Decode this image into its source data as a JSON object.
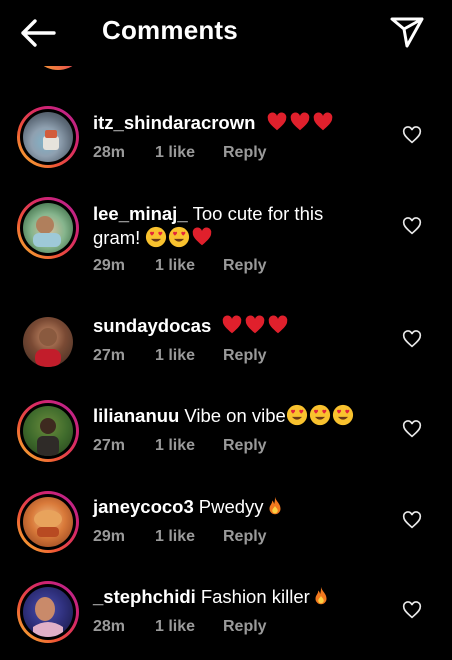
{
  "header": {
    "title": "Comments",
    "back_icon": "arrow-left-icon",
    "share_icon": "paper-plane-icon"
  },
  "colors": {
    "background": "#000000",
    "meta_text": "#9a9a9a",
    "story_ring_start": "#f7c531",
    "story_ring_end": "#b2239a",
    "heart": "#e0202c"
  },
  "comments": [
    {
      "username": "itz_shindaracrown",
      "text": "",
      "emojis": [
        "red-heart",
        "red-heart",
        "red-heart"
      ],
      "time": "28m",
      "likes": "1 like",
      "reply": "Reply",
      "story_ring": true
    },
    {
      "username": "lee_minaj_",
      "text": "Too cute for this",
      "text_line2": "gram!",
      "emojis": [
        "heart-eyes",
        "heart-eyes",
        "red-heart"
      ],
      "time": "29m",
      "likes": "1 like",
      "reply": "Reply",
      "story_ring": true
    },
    {
      "username": "sundaydocas",
      "text": "",
      "emojis": [
        "red-heart",
        "red-heart",
        "red-heart"
      ],
      "time": "27m",
      "likes": "1 like",
      "reply": "Reply",
      "story_ring": false
    },
    {
      "username": "liliananuu",
      "text": "Vibe on vibe",
      "emojis": [
        "heart-eyes",
        "heart-eyes",
        "heart-eyes"
      ],
      "time": "27m",
      "likes": "1 like",
      "reply": "Reply",
      "story_ring": true
    },
    {
      "username": "janeycoco3",
      "text": "Pwedyy",
      "emojis": [
        "fire"
      ],
      "time": "29m",
      "likes": "1 like",
      "reply": "Reply",
      "story_ring": true
    },
    {
      "username": "_stephchidi",
      "text": "Fashion killer",
      "emojis": [
        "fire"
      ],
      "time": "28m",
      "likes": "1 like",
      "reply": "Reply",
      "story_ring": true
    }
  ]
}
